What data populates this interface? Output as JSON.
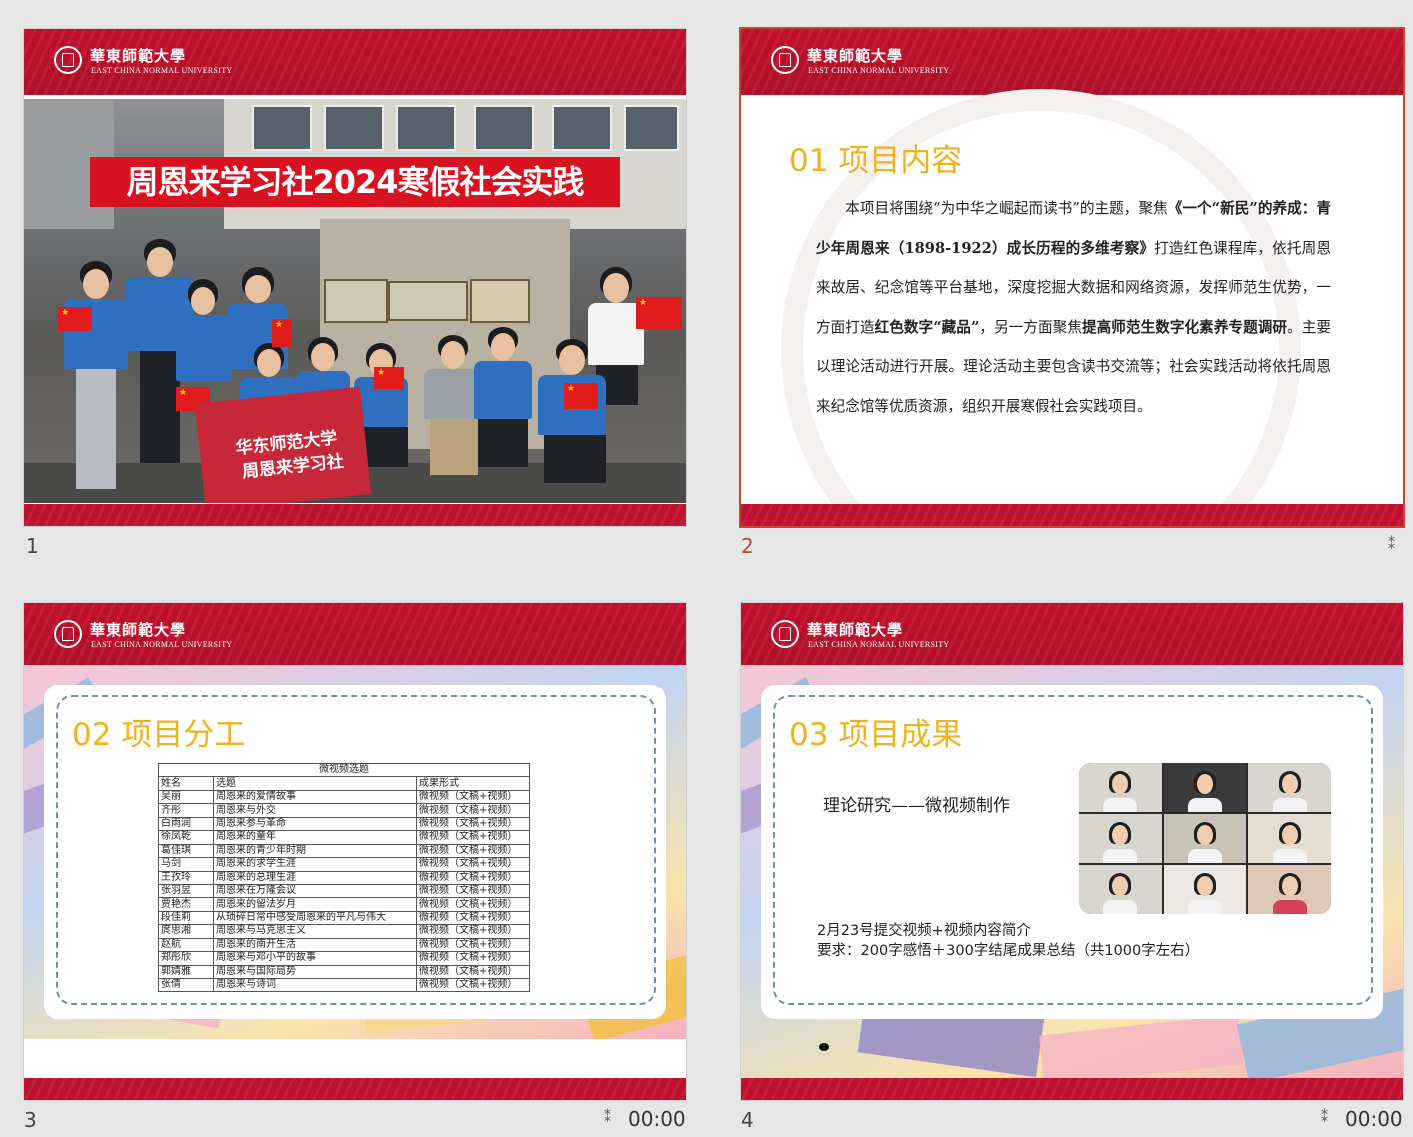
{
  "university": {
    "name_cn": "華東師範大學",
    "name_en": "EAST CHINA NORMAL UNIVERSITY"
  },
  "slides": [
    {
      "number": "1",
      "banner": "周恩来学习社2024寒假社会实践",
      "photo_flag_line1": "华东师范大学",
      "photo_flag_line2": "周恩来学习社"
    },
    {
      "number": "2",
      "title": "01 项目内容",
      "body": {
        "p1": "本项目将围绕“为中华之崛起而读书”的主题，聚焦",
        "b1": "《一个“新民”的养成：青少年周恩来（1898-1922）成长历程的多维考察》",
        "p2": "打造红色课程库，依托周恩来故居、纪念馆等平台基地，深度挖掘大数据和网络资源，发挥师范生优势，一方面打造",
        "b2": "红色数字“藏品”",
        "p3": "，另一方面聚焦",
        "b3": "提高师范生数字化素养专题调研",
        "p4": "。主要以理论活动进行开展。理论活动主要包含读书交流等；社会实践活动将依托周恩来纪念馆等优质资源，组织开展寒假社会实践项目。"
      }
    },
    {
      "number": "3",
      "title": "02 项目分工",
      "duration": "00:00",
      "table": {
        "caption": "微视频选题",
        "headers": [
          "姓名",
          "选题",
          "成果形式"
        ],
        "rows": [
          [
            "吴丽",
            "周恩来的爱情故事",
            "微视频（文稿+视频）"
          ],
          [
            "齐彤",
            "周恩来与外交",
            "微视频（文稿+视频）"
          ],
          [
            "白雨润",
            "周恩来参与革命",
            "微视频（文稿+视频）"
          ],
          [
            "徐凤乾",
            "周恩来的童年",
            "微视频（文稿+视频）"
          ],
          [
            "葛佳琪",
            "周恩来的青少年时期",
            "微视频（文稿+视频）"
          ],
          [
            "马剑",
            "周恩来的求学生涯",
            "微视频（文稿+视频）"
          ],
          [
            "王孜玲",
            "周恩来的总理生涯",
            "微视频（文稿+视频）"
          ],
          [
            "张羽昱",
            "周恩来在万隆会议",
            "微视频（文稿+视频）"
          ],
          [
            "贾艳杰",
            "周恩来的留法岁月",
            "微视频（文稿+视频）"
          ],
          [
            "段佳莉",
            "从琐碎日常中感受周恩来的平凡与伟大",
            "微视频（文稿+视频）"
          ],
          [
            "庹思湘",
            "周恩来与马克思主义",
            "微视频（文稿+视频）"
          ],
          [
            "赵航",
            "周恩来的南开生活",
            "微视频（文稿+视频）"
          ],
          [
            "郑彤欣",
            "周恩来与邓小平的故事",
            "微视频（文稿+视频）"
          ],
          [
            "郭婧雅",
            "周恩来与国际局势",
            "微视频（文稿+视频）"
          ],
          [
            "张倩",
            "周恩来与诗词",
            "微视频（文稿+视频）"
          ]
        ]
      }
    },
    {
      "number": "4",
      "title": "03 项目成果",
      "duration": "00:00",
      "theory": "理论研究——微视频制作",
      "line1": "2月23号提交视频+视频内容简介",
      "line2": "要求：200字感悟＋300字结尾成果总结（共1000字左右）"
    }
  ],
  "icons": {
    "animation": "star-animation-icon"
  },
  "colors": {
    "header_red": "#c6102e",
    "title_gold": "#f0b21a",
    "selection": "#c8462e"
  }
}
